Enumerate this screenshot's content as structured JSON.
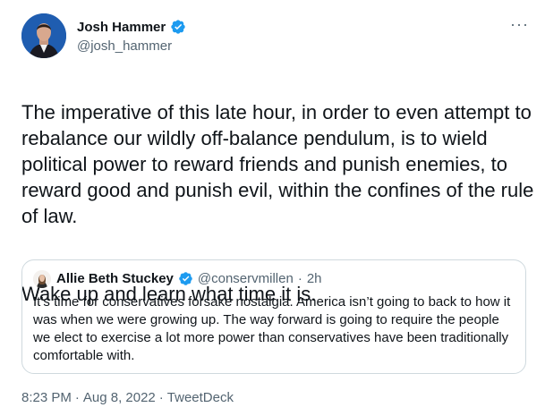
{
  "author": {
    "name": "Josh Hammer",
    "handle": "@josh_hammer"
  },
  "tweet": {
    "paragraph1": "The imperative of this late hour, in order to even attempt to rebalance our wildly off-balance pendulum, is to wield political power to reward friends and punish enemies, to reward good and punish evil, within the confines of the rule of law.",
    "paragraph2": "Wake up and learn what time it is."
  },
  "quoted": {
    "name": "Allie Beth Stuckey",
    "handle": "@conservmillen",
    "separator": "·",
    "time": "2h",
    "text": "It’s time for conservatives forsake nostalgia. America isn’t going to back to how it was when we were growing up. The way forward is going to require the people we elect to exercise a lot more power than conservatives have been traditionally comfortable with."
  },
  "meta": {
    "time": "8:23 PM",
    "sep1": "·",
    "date": "Aug 8, 2022",
    "sep2": "·",
    "source": "TweetDeck"
  },
  "more_label": "···",
  "colors": {
    "verified": "#1d9bf0",
    "secondary_text": "#536471",
    "border": "#cfd9de"
  }
}
